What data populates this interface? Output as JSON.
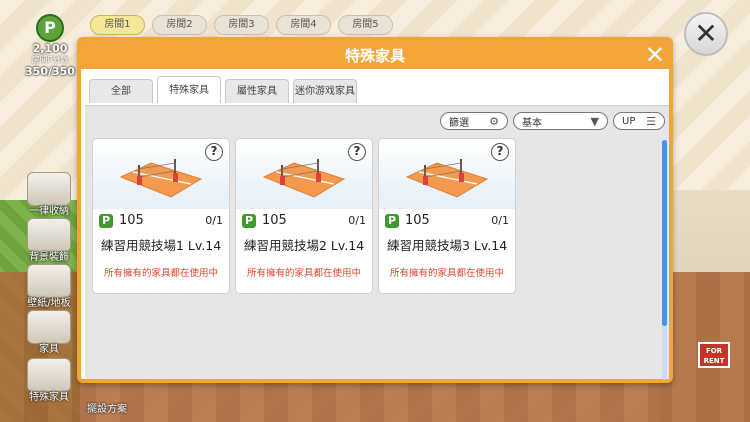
{
  "room_tabs": [
    {
      "label": "房間1",
      "active": true
    },
    {
      "label": "房間2",
      "active": false
    },
    {
      "label": "房間3",
      "active": false
    },
    {
      "label": "房間4",
      "active": false
    },
    {
      "label": "房間5",
      "active": false
    }
  ],
  "resource": {
    "icon": "p-coin-icon",
    "value": "2,100",
    "label": "房間P分數",
    "capacity": "350/350"
  },
  "side_menu": [
    {
      "label": "一律收納",
      "icon": "box-icon"
    },
    {
      "label": "背景裝飾",
      "icon": "scenery-icon"
    },
    {
      "label": "壁紙/地板",
      "icon": "wallpaper-icon"
    },
    {
      "label": "家具",
      "icon": "table-icon"
    },
    {
      "label": "特殊家具",
      "icon": "special-furniture-icon"
    },
    {
      "label": "擺設方案",
      "icon": "layout-plan-icon"
    }
  ],
  "for_rent": "FOR RENT",
  "modal": {
    "title": "特殊家具",
    "tabs": [
      {
        "label": "全部",
        "active": false
      },
      {
        "label": "特殊家具",
        "active": true
      },
      {
        "label": "屬性家具",
        "active": false
      },
      {
        "label": "迷你游戏家具",
        "active": false
      }
    ],
    "filters": {
      "filter_label": "篩選",
      "sort_label": "基本",
      "order_label": "UP"
    },
    "items": [
      {
        "name": "練習用競技場1 Lv.14",
        "price": "105",
        "count": "0/1",
        "status": "所有擁有的家具都在使用中"
      },
      {
        "name": "練習用競技場2 Lv.14",
        "price": "105",
        "count": "0/1",
        "status": "所有擁有的家具都在使用中"
      },
      {
        "name": "練習用競技場3 Lv.14",
        "price": "105",
        "count": "0/1",
        "status": "所有擁有的家具都在使用中"
      }
    ]
  },
  "colors": {
    "accent": "#f3a53a",
    "status": "#e0462f",
    "price_badge": "#3e9b2c",
    "scroll": "#4f92e0"
  }
}
